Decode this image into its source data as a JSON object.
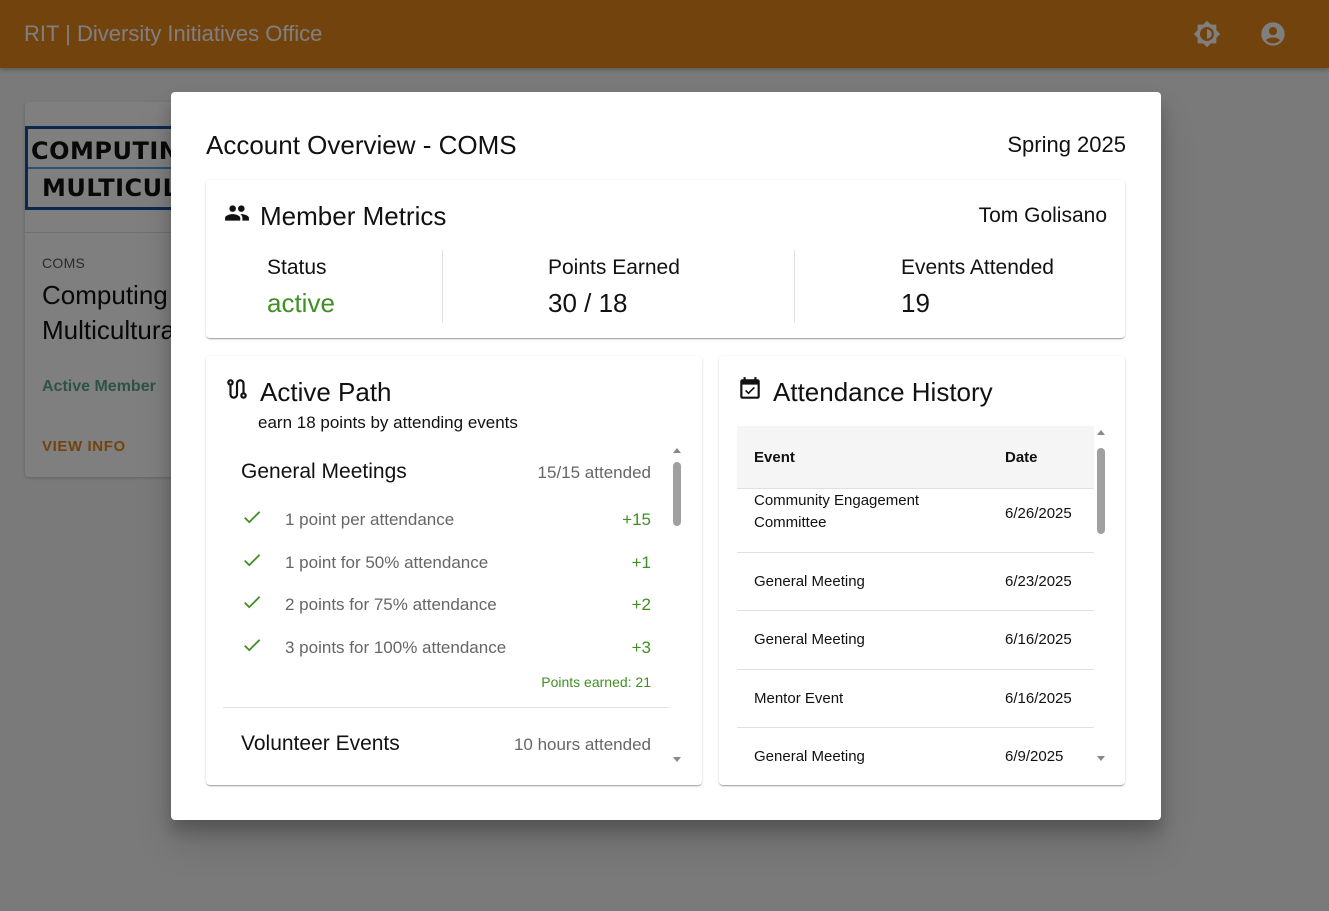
{
  "appbar": {
    "title": "RIT | Diversity Initiatives Office",
    "icons": [
      "brightness-icon",
      "account-circle-icon"
    ]
  },
  "background_card": {
    "logo_lines": [
      "COMPUTING",
      "MULTICULT"
    ],
    "abbr": "COMS",
    "name": "Computing Multicultural",
    "status": "Active Member",
    "view_label": "VIEW INFO"
  },
  "dialog": {
    "title": "Account Overview - COMS",
    "term": "Spring 2025",
    "metrics": {
      "heading": "Member Metrics",
      "member_name": "Tom Golisano",
      "status_label": "Status",
      "status_value": "active",
      "points_label": "Points Earned",
      "points_value": "30 / 18",
      "events_label": "Events Attended",
      "events_value": "19"
    },
    "path": {
      "heading": "Active Path",
      "subtitle": "earn 18 points by attending events",
      "sections": [
        {
          "name": "General Meetings",
          "count": "15/15 attended",
          "rules": [
            {
              "text": "1 point per attendance",
              "points": "+15"
            },
            {
              "text": "1 point for 50% attendance",
              "points": "+1"
            },
            {
              "text": "2 points for 75% attendance",
              "points": "+2"
            },
            {
              "text": "3 points for 100% attendance",
              "points": "+3"
            }
          ],
          "earned": "Points earned: 21"
        },
        {
          "name": "Volunteer Events",
          "count": "10 hours attended"
        }
      ]
    },
    "attendance": {
      "heading": "Attendance History",
      "col_event": "Event",
      "col_date": "Date",
      "rows": [
        {
          "event": "Community Engagement Committee",
          "date": "6/26/2025"
        },
        {
          "event": "General Meeting",
          "date": "6/23/2025"
        },
        {
          "event": "General Meeting",
          "date": "6/16/2025"
        },
        {
          "event": "Mentor Event",
          "date": "6/16/2025"
        },
        {
          "event": "General Meeting",
          "date": "6/9/2025"
        }
      ]
    }
  },
  "colors": {
    "appbar": "#e7861d",
    "accent_green": "#3f8f24",
    "active_member": "#5aa48d"
  }
}
